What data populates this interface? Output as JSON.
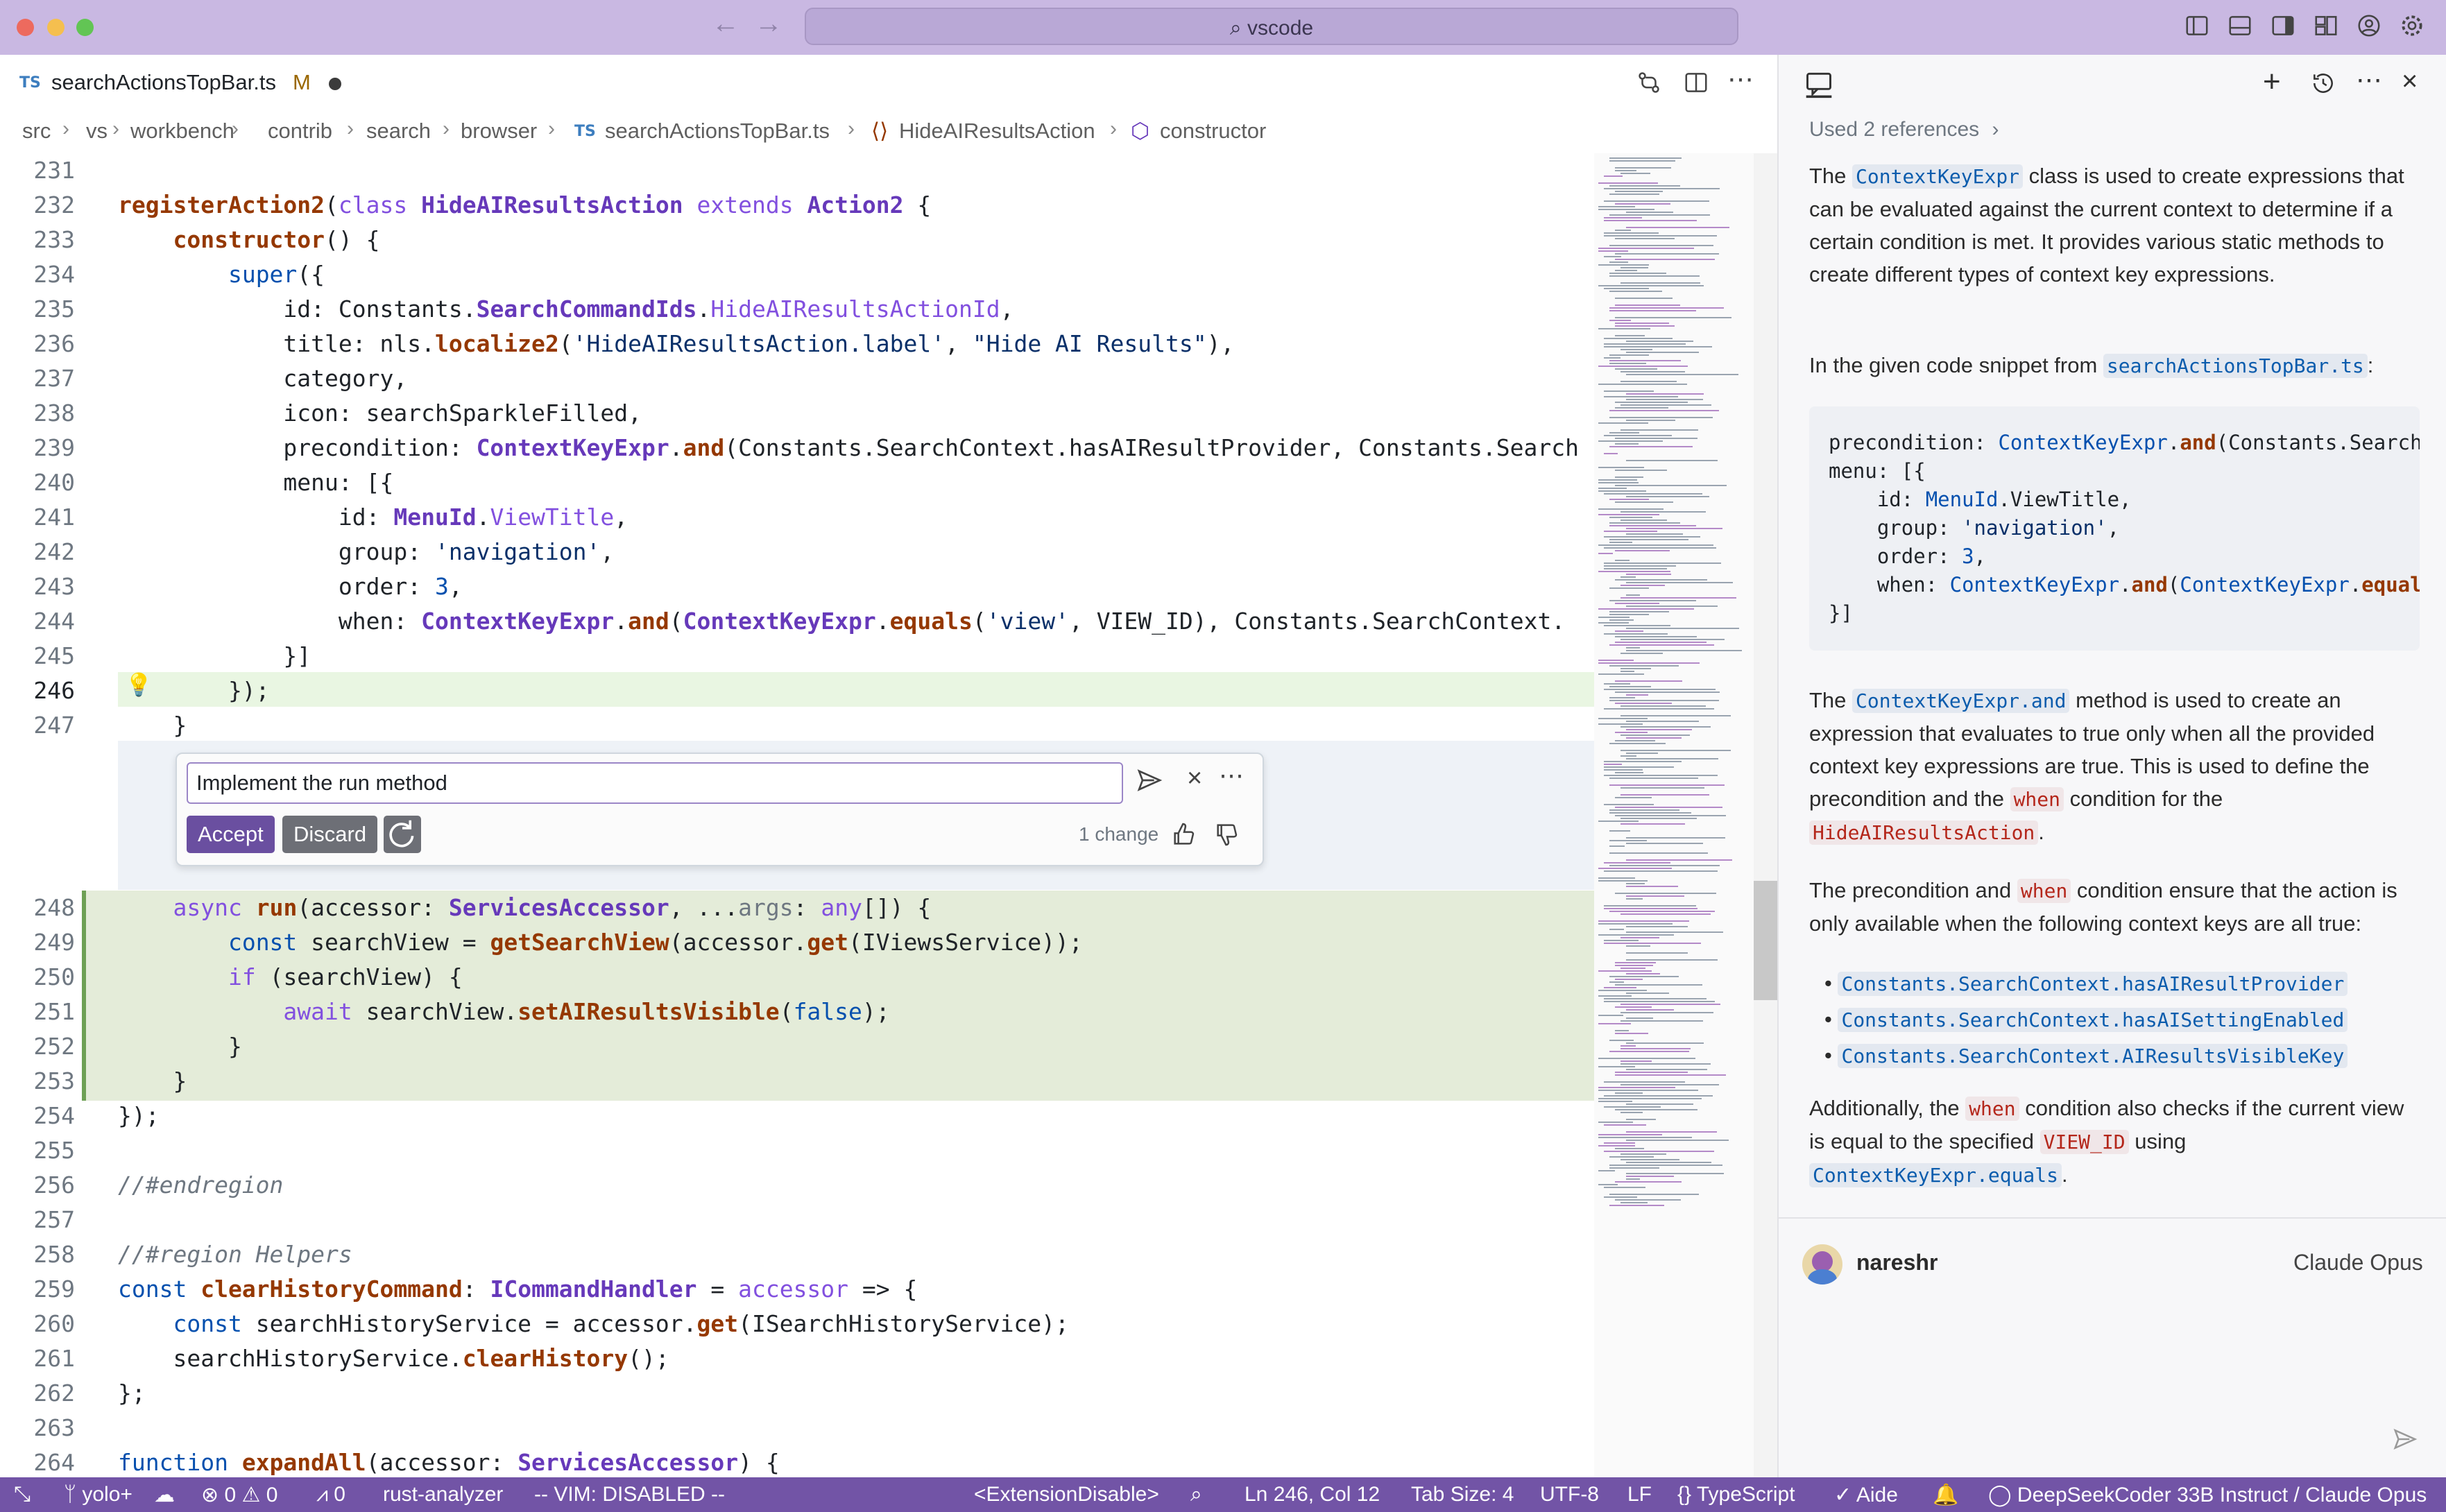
{
  "window": {
    "command_center": "vscode",
    "traffic_lights": {
      "close": "#ed6a5e",
      "minimize": "#f5bf4f",
      "maximize": "#62c554"
    }
  },
  "editor": {
    "tab": {
      "lang_badge": "TS",
      "filename": "searchActionsTopBar.ts",
      "status": "M"
    },
    "breadcrumb": [
      "src",
      "vs",
      "workbench",
      "contrib",
      "search",
      "browser",
      "searchActionsTopBar.ts",
      "HideAIResultsAction",
      "constructor"
    ],
    "breadcrumb_file_badge": "TS",
    "lines": {
      "231": "",
      "247": "}",
      "255": "",
      "257": "",
      "263": ""
    },
    "line_numbers": [
      "231",
      "232",
      "233",
      "234",
      "235",
      "236",
      "237",
      "238",
      "239",
      "240",
      "241",
      "242",
      "243",
      "244",
      "245",
      "246",
      "247",
      "248",
      "249",
      "250",
      "251",
      "252",
      "253",
      "254",
      "255",
      "256",
      "257",
      "258",
      "259",
      "260",
      "261",
      "262",
      "263",
      "264"
    ]
  },
  "inline_chat": {
    "input_value": "Implement the run method",
    "accept_label": "Accept",
    "discard_label": "Discard",
    "changes": "1 change"
  },
  "chat": {
    "references": "Used 2 references",
    "p1_pre": "The ",
    "p1_chip": "ContextKeyExpr",
    "p1_post": " class is used to create expressions that can be evaluated against the current context to determine if a certain condition is met. It provides various static methods to create different types of context key expressions.",
    "p2_pre": "In the given code snippet from ",
    "p2_chip": "searchActionsTopBar.ts",
    "p2_post": ":",
    "code": [
      "precondition: ContextKeyExpr.and(Constants.Search",
      "menu: [{",
      "    id: MenuId.ViewTitle,",
      "    group: 'navigation',",
      "    order: 3,",
      "    when: ContextKeyExpr.and(ContextKeyExpr.equal",
      "}]"
    ],
    "p3_pre": "The ",
    "p3_chip": "ContextKeyExpr.and",
    "p3_mid": " method is used to create an expression that evaluates to true only when all the provided context key expressions are true. This is used to define the precondition and the ",
    "p3_when": "when",
    "p3_mid2": " condition for the ",
    "p3_chip2": "HideAIResultsAction",
    "p3_post": ".",
    "p4_pre": "The precondition and ",
    "p4_when": "when",
    "p4_post": " condition ensure that the action is only available when the following context keys are all true:",
    "bullets": [
      "Constants.SearchContext.hasAIResultProvider",
      "Constants.SearchContext.hasAISettingEnabled",
      "Constants.SearchContext.AIResultsVisibleKey"
    ],
    "p5_pre": "Additionally, the ",
    "p5_when": "when",
    "p5_mid": " condition also checks if the current view is equal to the specified ",
    "p5_chip": "VIEW_ID",
    "p5_mid2": " using ",
    "p5_chip2": "ContextKeyExpr.equals",
    "p5_post": ".",
    "user": "nareshr",
    "model": "Claude Opus"
  },
  "statusbar": {
    "branch": "yolo+",
    "errors": "0",
    "warnings": "0",
    "ports": "0",
    "analyzer": "rust-analyzer",
    "vim": "-- VIM: DISABLED --",
    "ext": "<ExtensionDisable>",
    "position": "Ln 246, Col 12",
    "tab_size": "Tab Size: 4",
    "encoding": "UTF-8",
    "eol": "LF",
    "language": "TypeScript",
    "aide": "Aide",
    "models": "DeepSeekCoder 33B Instruct / Claude Opus"
  },
  "colors": {
    "titlebar": "#c9b8e2",
    "statusbar": "#7254a6",
    "accent": "#6a4fa0",
    "diff_added": "#e4ecd9"
  }
}
